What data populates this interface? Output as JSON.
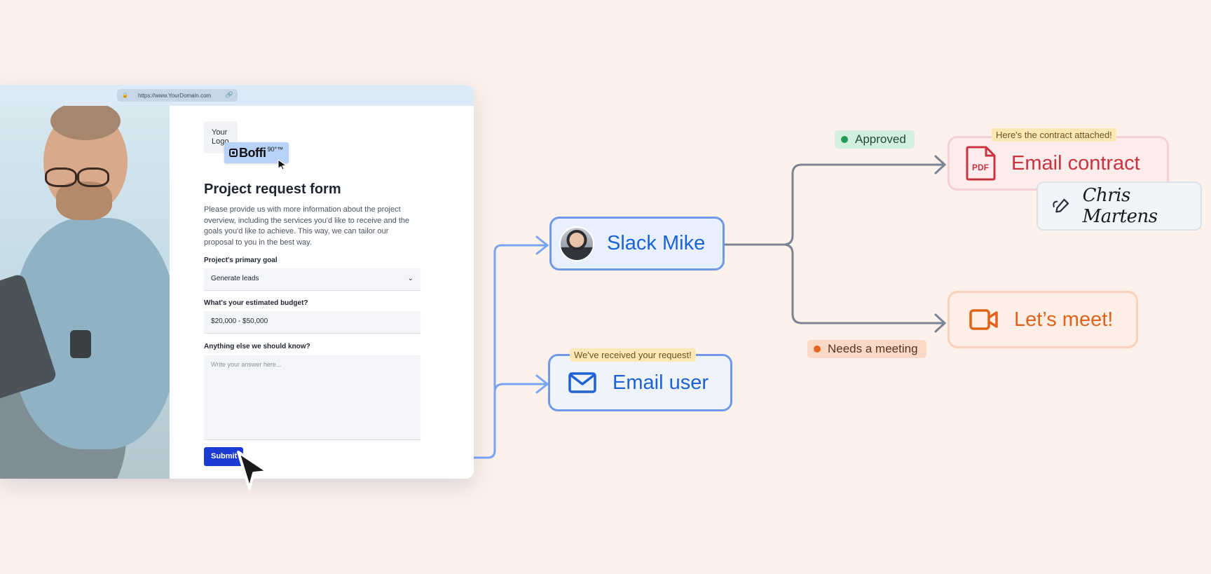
{
  "browser": {
    "url": "https://www.YourDomain.com"
  },
  "form": {
    "logo_placeholder": "Your Logo",
    "brand_chip": {
      "name": "Boffi",
      "superscript": "90°™"
    },
    "title": "Project request form",
    "description": "Please provide us with more information about the project overview, including the services you'd like to receive and the goals you'd like to achieve. This way, we can tailor our proposal to you in the best way.",
    "goal_label": "Project's primary goal",
    "goal_value": "Generate leads",
    "budget_label": "What's your estimated budget?",
    "budget_value": "$20,000 - $50,000",
    "notes_label": "Anything else we should know?",
    "notes_placeholder": "Write your answer here...",
    "submit_label": "Submit"
  },
  "workflow": {
    "slack_node": {
      "label": "Slack Mike"
    },
    "email_user_node": {
      "label": "Email user",
      "badge": "We've received your request!"
    },
    "contract_node": {
      "label": "Email contract",
      "badge": "Here's the contract attached!",
      "icon_text": "PDF"
    },
    "signature": {
      "name": "Chris Martens"
    },
    "meet_node": {
      "label": "Let’s meet!"
    },
    "status_approved": {
      "label": "Approved",
      "color": "#1f9d55"
    },
    "status_meeting": {
      "label": "Needs a meeting",
      "color": "#e8641e"
    }
  },
  "colors": {
    "background": "#fdf1eb",
    "accent_blue": "#6f98e9",
    "connector_gray": "#7b8494",
    "submit_blue": "#1c3bd3"
  }
}
